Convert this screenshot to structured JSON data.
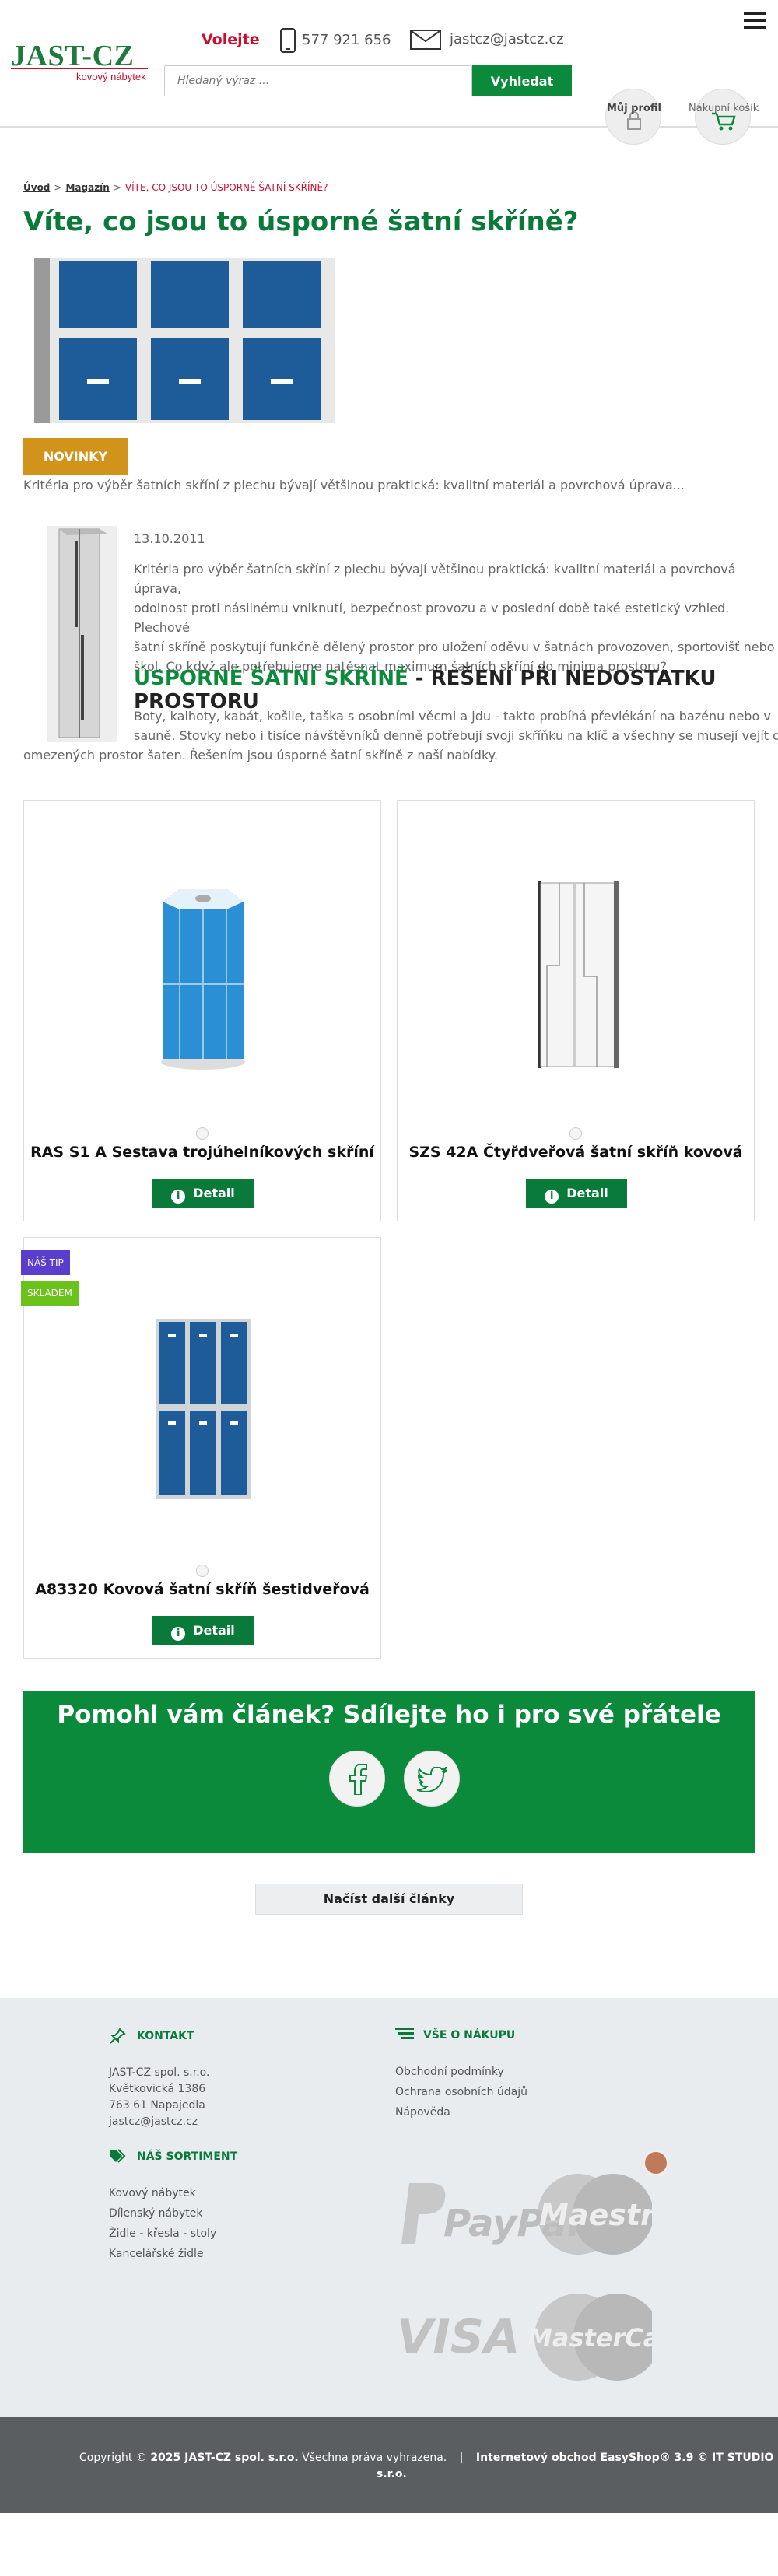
{
  "header": {
    "logo_main": "JAST-CZ",
    "logo_sub": "kovový nábytek",
    "call_label": "Volejte",
    "phone": "577 921 656",
    "email": "jastcz@jastcz.cz",
    "search_placeholder": "Hledaný výraz ...",
    "search_button": "Vyhledat",
    "profile_label": "Můj profil",
    "cart_label": "Nákupní košík"
  },
  "breadcrumb": {
    "home": "Úvod",
    "magazine": "Magazín",
    "current": "VÍTE, CO JSOU TO ÚSPORNÉ ŠATNÍ SKŘÍNĚ?"
  },
  "article": {
    "title": "Víte, co jsou to úsporné šatní skříně?",
    "tag": "NOVINKY",
    "excerpt": "Kritéria pro výběr šatních skříní z plechu bývají většinou praktická: kvalitní materiál a povrchová úprava...",
    "date": "13.10.2011",
    "p1_l1": "Kritéria pro výběr šatních skříní z plechu bývají většinou praktická: kvalitní materiál a povrchová úprava,",
    "p1_l2": "odolnost proti násilnému vniknutí, bezpečnost provozu a v poslední době také estetický vzhled. Plechové",
    "p1_l3": "šatní skříně poskytují funkčně dělený prostor pro uložení oděvu v šatnách provozoven, sportovišť nebo",
    "p1_l4": "škol. Co když ale potřebujeme natěsnat maximum šatních skříní do minima prostoru?",
    "subhead_green": "ÚSPORNÉ ŠATNÍ SKŘÍNĚ",
    "subhead_rest": " - ŘEŠENÍ PŘI NEDOSTATKU PROSTORU",
    "p2_l1": "Boty, kalhoty, kabát, košile, taška s osobními věcmi a jdu - takto probíhá převlékání na bazénu nebo v",
    "p2_l2": "sauně. Stovky nebo i tisíce návštěvníků denně potřebují svoji skříňku na klíč a všechny se musejí vejít do",
    "p2_l3": "omezených prostor šaten. Řešením jsou úsporné šatní skříně z naší nabídky."
  },
  "products": [
    {
      "title": "RAS S1 A Sestava trojúhelníkových skříní",
      "button": "Detail"
    },
    {
      "title": "SZS 42A Čtyřdveřová šatní skříň kovová",
      "button": "Detail"
    },
    {
      "title": "A83320 Kovová šatní skříň šestidveřová",
      "button": "Detail",
      "badges": [
        "NÁŠ TIP",
        "SKLADEM"
      ]
    }
  ],
  "share": {
    "title": "Pomohl vám článek? Sdílejte ho i pro své přátele"
  },
  "load_more": "Načíst další články",
  "footer": {
    "contact_head": "KONTAKT",
    "contact_lines": [
      "JAST-CZ spol. s.r.o.",
      "Květkovická 1386",
      "763 61 Napajedla",
      "jastcz@jastcz.cz"
    ],
    "assortment_head": "NÁŠ SORTIMENT",
    "assortment": [
      "Kovový nábytek",
      "Dílenský nábytek",
      "Židle - křesla - stoly",
      "Kancelářské židle"
    ],
    "shopping_head": "VŠE O NÁKUPU",
    "shopping": [
      "Obchodní podmínky",
      "Ochrana osobních údajů",
      "Nápověda"
    ],
    "pay_logos": [
      "PayPal",
      "Maestro",
      "VISA",
      "MasterCard"
    ]
  },
  "copyright": {
    "prefix": "Copyright © ",
    "year_company": "2025 JAST-CZ spol. s.r.o.",
    "rights": " Všechna práva vyhrazena.",
    "separator": "|",
    "shop": "Internetový obchod EasyShop® 3.9 © IT STUDIO",
    "shop_l2": "s.r.o."
  }
}
